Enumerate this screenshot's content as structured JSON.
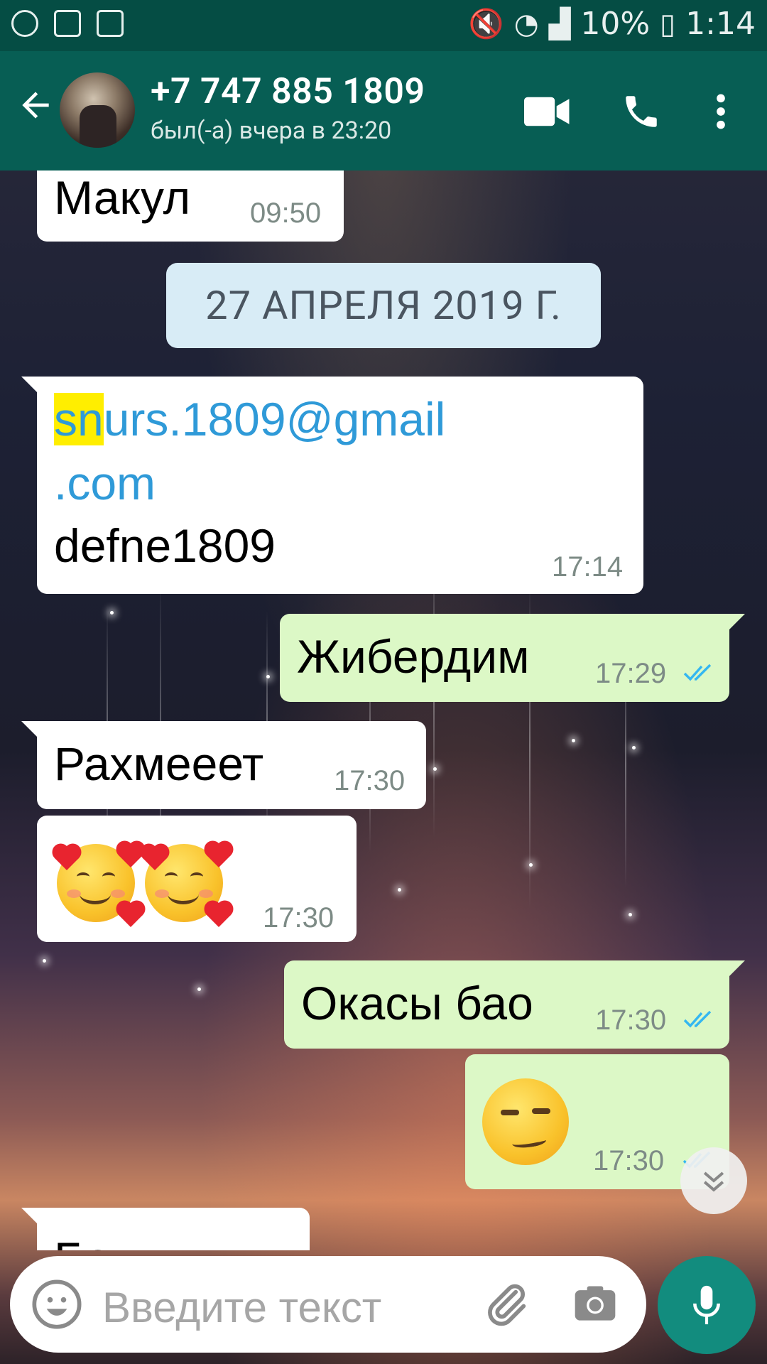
{
  "status_bar": {
    "battery": "10%",
    "time": "1:14"
  },
  "header": {
    "contact_name": "+7 747 885 1809",
    "last_seen": "был(-а) вчера в 23:20"
  },
  "messages": [
    {
      "dir": "in",
      "text": "Макул",
      "time": "09:50"
    },
    {
      "type": "date",
      "text": "27 АПРЕЛЯ 2019 Г."
    },
    {
      "dir": "in",
      "email_highlight": "sn",
      "email_rest": "urs.1809@gmail",
      "email_tail": ".com",
      "text2": "defne1809",
      "time": "17:14"
    },
    {
      "dir": "out",
      "text": "Жибердим",
      "time": "17:29"
    },
    {
      "dir": "in",
      "text": "Рахмееет",
      "time": "17:30"
    },
    {
      "dir": "in",
      "emoji": "smiling-face-with-hearts x2",
      "time": "17:30"
    },
    {
      "dir": "out",
      "text": "Окасы бао",
      "time": "17:30"
    },
    {
      "dir": "out",
      "emoji": "smirking-face",
      "time": "17:30"
    },
    {
      "dir": "in",
      "text": "Белл"
    }
  ],
  "input": {
    "placeholder": "Введите текст"
  },
  "colors": {
    "app_bar": "#075e54",
    "status_bar": "#054d44",
    "incoming": "#ffffff",
    "outgoing": "#dcf8c6",
    "read_ticks": "#34b7f1",
    "mic_button": "#128c7e"
  },
  "icons": [
    "back-arrow-icon",
    "video-call-icon",
    "phone-icon",
    "more-options-icon",
    "emoji-icon",
    "attach-icon",
    "camera-icon",
    "microphone-icon",
    "scroll-down-icon",
    "read-ticks-icon"
  ]
}
